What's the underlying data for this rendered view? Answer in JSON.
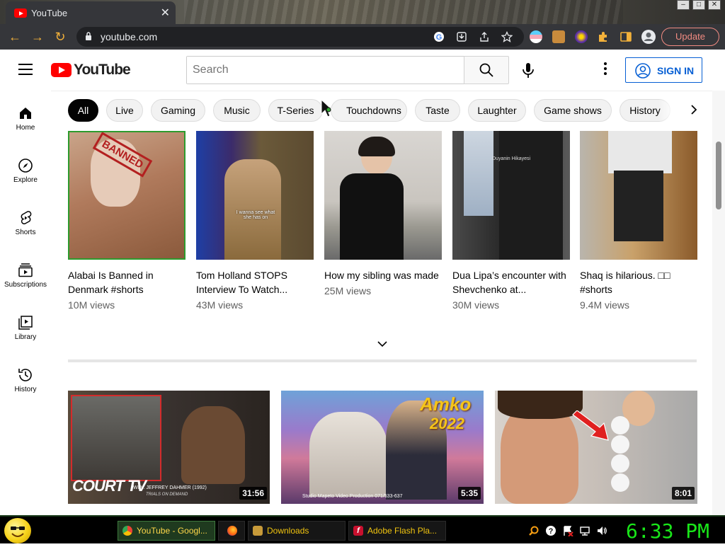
{
  "browser": {
    "tab_title": "YouTube",
    "url": "youtube.com",
    "update_label": "Update"
  },
  "header": {
    "logo_text": "YouTube",
    "search_placeholder": "Search",
    "signin_label": "SIGN IN"
  },
  "chips": [
    "All",
    "Live",
    "Gaming",
    "Music",
    "T-Series",
    "Touchdowns",
    "Taste",
    "Laughter",
    "Game shows",
    "History"
  ],
  "sidebar": {
    "items": [
      {
        "label": "Home"
      },
      {
        "label": "Explore"
      },
      {
        "label": "Shorts"
      },
      {
        "label": "Subscriptions"
      },
      {
        "label": "Library"
      },
      {
        "label": "History"
      }
    ]
  },
  "shorts": [
    {
      "title": "Alabai Is Banned in Denmark #shorts",
      "views": "10M views",
      "overlay": "BANNED"
    },
    {
      "title": "Tom Holland STOPS Interview To Watch...",
      "views": "43M views",
      "overlay": "I wanna see what she has on"
    },
    {
      "title": "How my sibling was made",
      "views": "25M views",
      "overlay": ""
    },
    {
      "title": "Dua Lipa’s encounter with Shevchenko at...",
      "views": "30M views",
      "overlay": "Duyanin Hikayesi"
    },
    {
      "title": "Shaq is hilarious. □□ #shorts",
      "views": "9.4M views",
      "overlay": ""
    }
  ],
  "videos": [
    {
      "duration": "31:56",
      "overlay_main": "COURT TV",
      "overlay_sub": "WI V. JEFFREY DAHMER (1992)",
      "overlay_sub2": "TRIALS ON DEMAND"
    },
    {
      "duration": "5:35",
      "overlay_main": "Amko",
      "overlay_sub": "2022",
      "overlay_sub2": "Studio Mapeto Video Production  071/533-637"
    },
    {
      "duration": "8:01",
      "overlay_main": "",
      "overlay_sub": "",
      "overlay_sub2": ""
    }
  ],
  "taskbar": {
    "tasks": [
      "YouTube - Googl...",
      "",
      "Downloads",
      "Adobe Flash Pla..."
    ],
    "clock": "6:33 PM"
  },
  "colors": {
    "yt_red": "#ff0000",
    "link_blue": "#065fd4",
    "chrome_dark": "#35363a",
    "clock_green": "#19e619",
    "task_text": "#f1c40f"
  }
}
